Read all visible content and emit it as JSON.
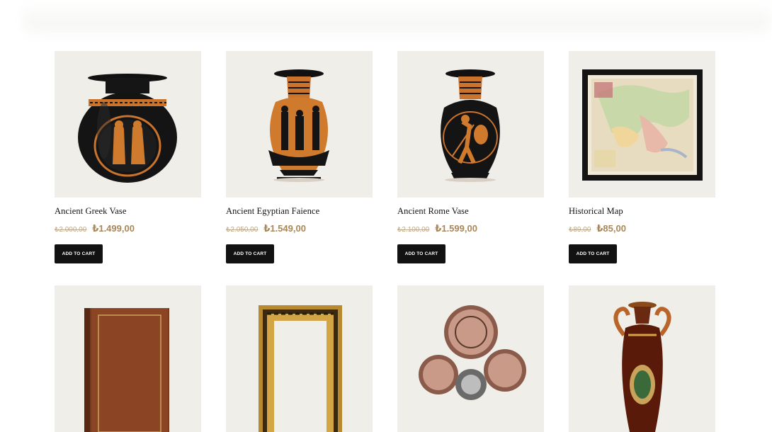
{
  "products_row1": [
    {
      "name": "Ancient Greek Vase",
      "old_price": "₺2.000,00",
      "price": "₺1.499,00",
      "image": "greek-vase-icon"
    },
    {
      "name": "Ancient Egyptian Faience",
      "old_price": "₺2.050,00",
      "price": "₺1.549,00",
      "image": "egyptian-amphora-icon"
    },
    {
      "name": "Ancient Rome Vase",
      "old_price": "₺2.100,00",
      "price": "₺1.599,00",
      "image": "roman-vase-icon"
    },
    {
      "name": "Historical Map",
      "old_price": "₺89,00",
      "price": "₺85,00",
      "image": "framed-map-icon"
    }
  ],
  "products_row2": [
    {
      "image": "leather-book-icon"
    },
    {
      "image": "gilded-frame-icon"
    },
    {
      "image": "astronomical-clock-icon"
    },
    {
      "image": "ornate-urn-icon"
    }
  ],
  "cart_button_label": "ADD TO CART",
  "colors": {
    "thumb_bg": "#efeee8",
    "price": "#a8875a",
    "old_price": "#bda98a",
    "button": "#121212"
  }
}
